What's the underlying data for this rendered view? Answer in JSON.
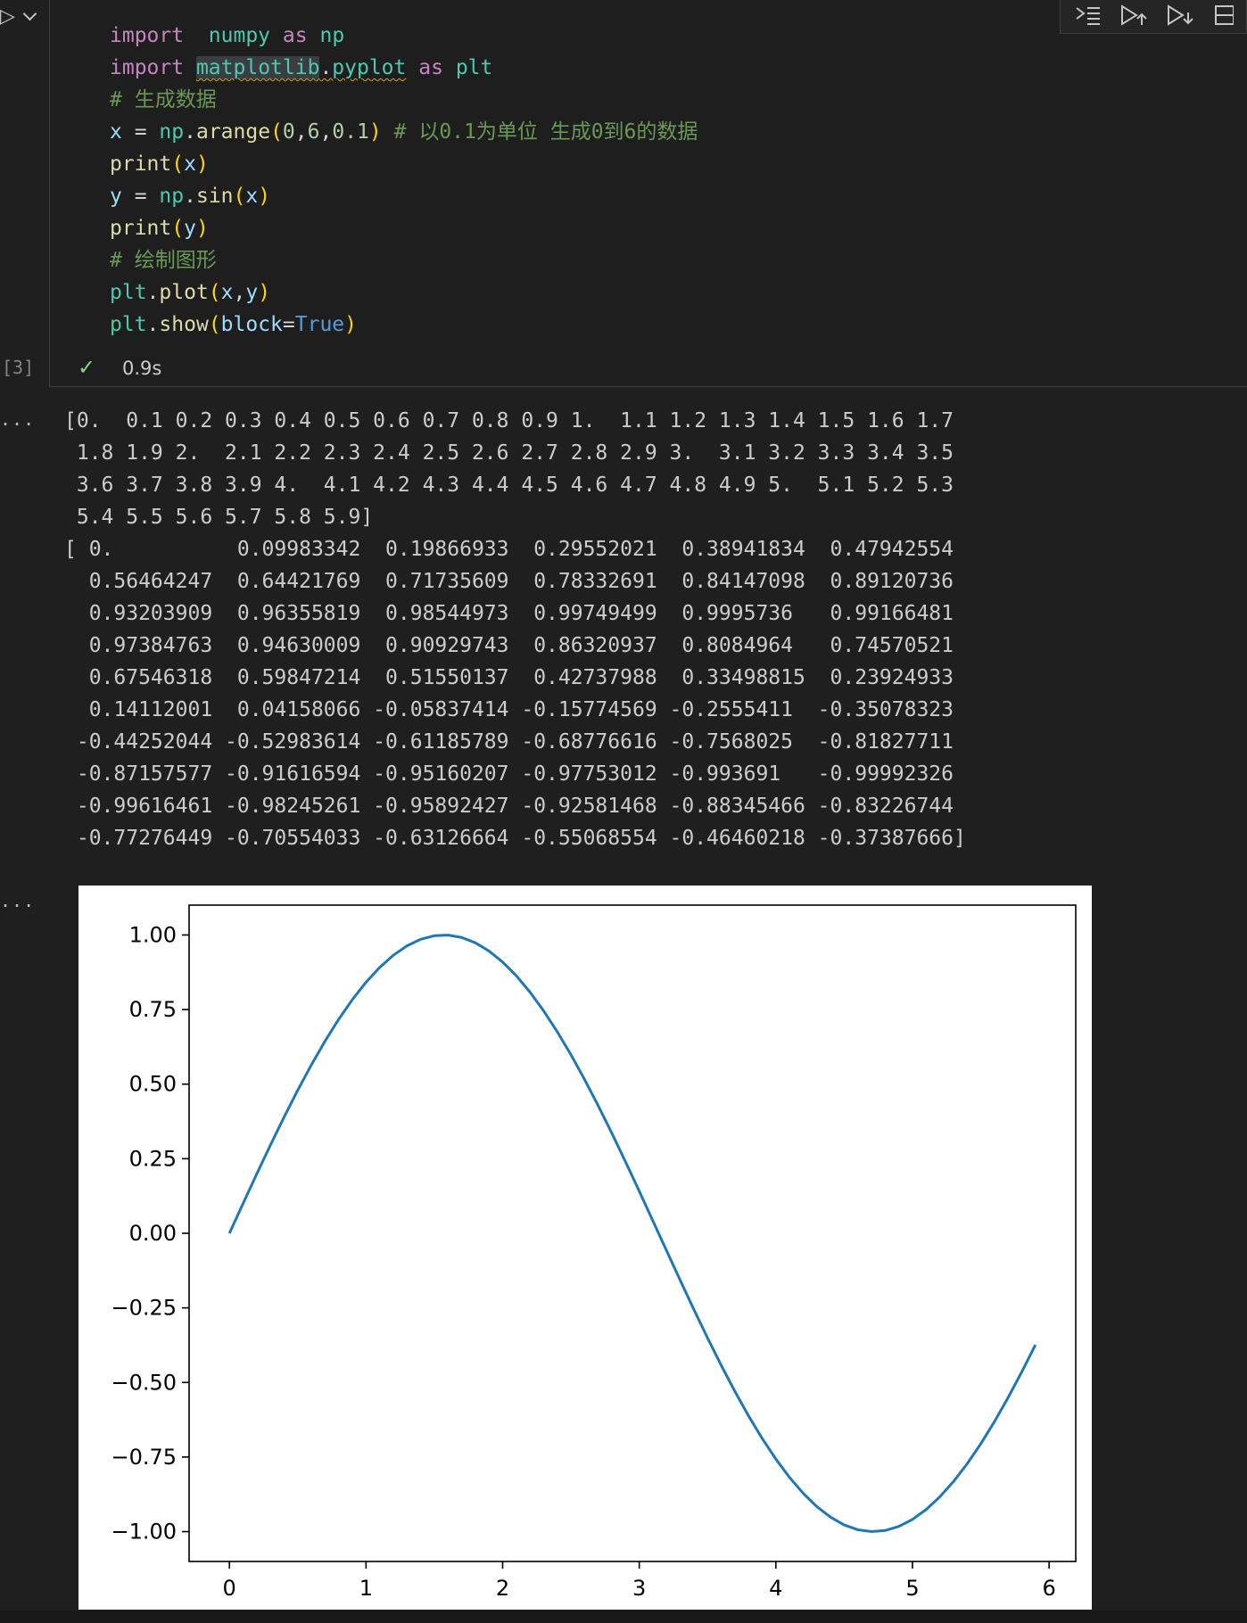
{
  "cell": {
    "execution_count": "[3]",
    "status_time": "0.9s",
    "code_lines": [
      [
        [
          "kw",
          "import"
        ],
        [
          "",
          "  "
        ],
        [
          "mod",
          "numpy"
        ],
        [
          "",
          " "
        ],
        [
          "kw",
          "as"
        ],
        [
          "",
          " "
        ],
        [
          "mod",
          "np"
        ]
      ],
      [
        [
          "kw",
          "import"
        ],
        [
          "",
          " "
        ],
        [
          "mod squig hl",
          "matplotlib"
        ],
        [
          "squig",
          "."
        ],
        [
          "mod squig",
          "pyplot"
        ],
        [
          "",
          " "
        ],
        [
          "kw",
          "as"
        ],
        [
          "",
          " "
        ],
        [
          "mod",
          "plt"
        ]
      ],
      [
        [
          "cm",
          "# 生成数据"
        ]
      ],
      [
        [
          "var",
          "x"
        ],
        [
          "",
          " = "
        ],
        [
          "mod",
          "np"
        ],
        [
          "",
          "."
        ],
        [
          "fn",
          "arange"
        ],
        [
          "pn",
          "("
        ],
        [
          "num",
          "0"
        ],
        [
          "",
          ","
        ],
        [
          "num",
          "6"
        ],
        [
          "",
          ","
        ],
        [
          "num",
          "0.1"
        ],
        [
          "pn",
          ")"
        ],
        [
          "",
          " "
        ],
        [
          "cm",
          "# 以0.1为单位 生成0到6的数据"
        ]
      ],
      [
        [
          "fn",
          "print"
        ],
        [
          "pn",
          "("
        ],
        [
          "var",
          "x"
        ],
        [
          "pn",
          ")"
        ]
      ],
      [
        [
          "var",
          "y"
        ],
        [
          "",
          " = "
        ],
        [
          "mod",
          "np"
        ],
        [
          "",
          "."
        ],
        [
          "fn",
          "sin"
        ],
        [
          "pn",
          "("
        ],
        [
          "var",
          "x"
        ],
        [
          "pn",
          ")"
        ]
      ],
      [
        [
          "fn",
          "print"
        ],
        [
          "pn",
          "("
        ],
        [
          "var",
          "y"
        ],
        [
          "pn",
          ")"
        ]
      ],
      [
        [
          "cm",
          "# 绘制图形"
        ]
      ],
      [
        [
          "mod",
          "plt"
        ],
        [
          "",
          "."
        ],
        [
          "fn",
          "plot"
        ],
        [
          "pn",
          "("
        ],
        [
          "var",
          "x"
        ],
        [
          "",
          ","
        ],
        [
          "var",
          "y"
        ],
        [
          "pn",
          ")"
        ]
      ],
      [
        [
          "mod",
          "plt"
        ],
        [
          "",
          "."
        ],
        [
          "fn",
          "show"
        ],
        [
          "pn",
          "("
        ],
        [
          "var",
          "block"
        ],
        [
          "",
          "="
        ],
        [
          "const",
          "True"
        ],
        [
          "pn",
          ")"
        ]
      ]
    ]
  },
  "output_dots": "...",
  "output_text": "[0.  0.1 0.2 0.3 0.4 0.5 0.6 0.7 0.8 0.9 1.  1.1 1.2 1.3 1.4 1.5 1.6 1.7\n 1.8 1.9 2.  2.1 2.2 2.3 2.4 2.5 2.6 2.7 2.8 2.9 3.  3.1 3.2 3.3 3.4 3.5\n 3.6 3.7 3.8 3.9 4.  4.1 4.2 4.3 4.4 4.5 4.6 4.7 4.8 4.9 5.  5.1 5.2 5.3\n 5.4 5.5 5.6 5.7 5.8 5.9]\n[ 0.          0.09983342  0.19866933  0.29552021  0.38941834  0.47942554\n  0.56464247  0.64421769  0.71735609  0.78332691  0.84147098  0.89120736\n  0.93203909  0.96355819  0.98544973  0.99749499  0.9995736   0.99166481\n  0.97384763  0.94630009  0.90929743  0.86320937  0.8084964   0.74570521\n  0.67546318  0.59847214  0.51550137  0.42737988  0.33498815  0.23924933\n  0.14112001  0.04158066 -0.05837414 -0.15774569 -0.2555411  -0.35078323\n -0.44252044 -0.52983614 -0.61185789 -0.68776616 -0.7568025  -0.81827711\n -0.87157577 -0.91616594 -0.95160207 -0.97753012 -0.993691   -0.99992326\n -0.99616461 -0.98245261 -0.95892427 -0.92581468 -0.88345466 -0.83226744\n -0.77276449 -0.70554033 -0.63126664 -0.55068554 -0.46460218 -0.37387666]",
  "toolbar_icons": [
    "run-by-line-icon",
    "execute-above-icon",
    "execute-below-icon",
    "split-cell-icon"
  ],
  "chart_data": {
    "type": "line",
    "x_start": 0.0,
    "x_end": 5.9,
    "x_step": 0.1,
    "y": [
      0.0,
      0.09983342,
      0.19866933,
      0.29552021,
      0.38941834,
      0.47942554,
      0.56464247,
      0.64421769,
      0.71735609,
      0.78332691,
      0.84147098,
      0.89120736,
      0.93203909,
      0.96355819,
      0.98544973,
      0.99749499,
      0.9995736,
      0.99166481,
      0.97384763,
      0.94630009,
      0.90929743,
      0.86320937,
      0.8084964,
      0.74570521,
      0.67546318,
      0.59847214,
      0.51550137,
      0.42737988,
      0.33498815,
      0.23924933,
      0.14112001,
      0.04158066,
      -0.05837414,
      -0.15774569,
      -0.2555411,
      -0.35078323,
      -0.44252044,
      -0.52983614,
      -0.61185789,
      -0.68776616,
      -0.7568025,
      -0.81827711,
      -0.87157577,
      -0.91616594,
      -0.95160207,
      -0.97753012,
      -0.993691,
      -0.99992326,
      -0.99616461,
      -0.98245261,
      -0.95892427,
      -0.92581468,
      -0.88345466,
      -0.83226744,
      -0.77276449,
      -0.70554033,
      -0.63126664,
      -0.55068554,
      -0.46460218,
      -0.37387666
    ],
    "xlim": [
      -0.295,
      6.195
    ],
    "ylim": [
      -1.1,
      1.1
    ],
    "xticks": [
      0,
      1,
      2,
      3,
      4,
      5,
      6
    ],
    "xtick_labels": [
      "0",
      "1",
      "2",
      "3",
      "4",
      "5",
      "6"
    ],
    "yticks": [
      1.0,
      0.75,
      0.5,
      0.25,
      0.0,
      -0.25,
      -0.5,
      -0.75,
      -1.0
    ],
    "ytick_labels": [
      "1.00",
      "0.75",
      "0.50",
      "0.25",
      "0.00",
      "−0.25",
      "−0.50",
      "−0.75",
      "−1.00"
    ],
    "line_color": "#1f77b4",
    "grid": false
  }
}
